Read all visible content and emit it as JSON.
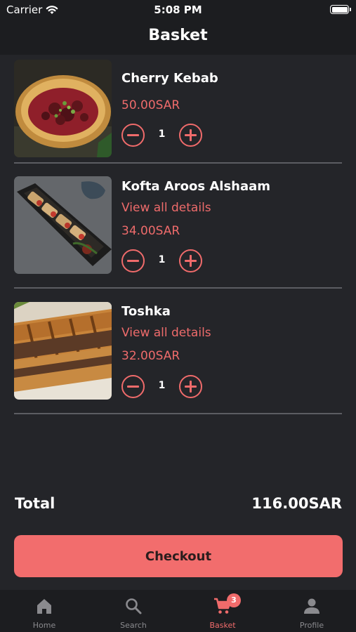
{
  "status_bar": {
    "carrier": "Carrier",
    "time": "5:08 PM"
  },
  "header": {
    "title": "Basket"
  },
  "items": [
    {
      "name": "Cherry Kebab",
      "details_link": "",
      "price": "50.00SAR",
      "quantity": "1"
    },
    {
      "name": "Kofta Aroos Alshaam",
      "details_link": "View all details",
      "price": "34.00SAR",
      "quantity": "1"
    },
    {
      "name": "Toshka",
      "details_link": "View all details",
      "price": "32.00SAR",
      "quantity": "1"
    }
  ],
  "summary": {
    "total_label": "Total",
    "total_value": "116.00SAR"
  },
  "checkout": {
    "label": "Checkout"
  },
  "tabs": [
    {
      "label": "Home",
      "icon": "home-icon"
    },
    {
      "label": "Search",
      "icon": "search-icon"
    },
    {
      "label": "Basket",
      "icon": "cart-icon",
      "badge": "3"
    },
    {
      "label": "Profile",
      "icon": "person-icon"
    }
  ],
  "colors": {
    "accent": "#f26d6d",
    "background": "#242529",
    "bar": "#1c1d20",
    "inactive": "#8a8a8e"
  }
}
